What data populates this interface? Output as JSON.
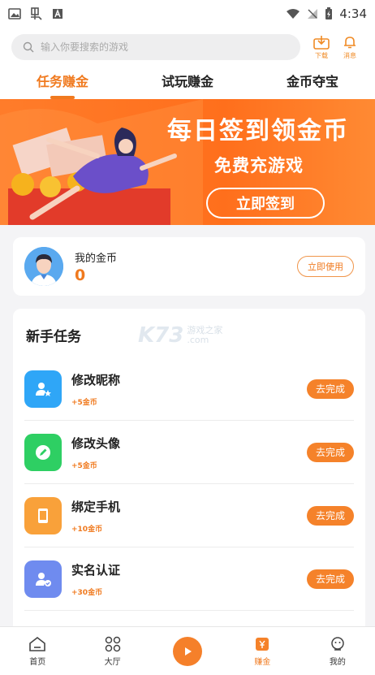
{
  "status_bar": {
    "time": "4:34"
  },
  "header": {
    "search_placeholder": "输入你要搜索的游戏",
    "download_label": "下载",
    "messages_label": "消息"
  },
  "tabs": [
    {
      "label": "任务赚金",
      "active": true
    },
    {
      "label": "试玩赚金",
      "active": false
    },
    {
      "label": "金币夺宝",
      "active": false
    }
  ],
  "banner": {
    "title": "每日签到领金币",
    "subtitle": "免费充游戏",
    "button_label": "立即签到"
  },
  "coins": {
    "label": "我的金币",
    "value": "0",
    "use_button_label": "立即使用"
  },
  "tasks": {
    "title": "新手任务",
    "items": [
      {
        "name": "修改昵称",
        "reward": "+5金币",
        "button": "去完成",
        "color": "#2fa6f7",
        "icon": "user-star-icon"
      },
      {
        "name": "修改头像",
        "reward": "+5金币",
        "button": "去完成",
        "color": "#2ecf63",
        "icon": "pencil-icon"
      },
      {
        "name": "绑定手机",
        "reward": "+10金币",
        "button": "去完成",
        "color": "#f9a13a",
        "icon": "phone-icon"
      },
      {
        "name": "实名认证",
        "reward": "+30金币",
        "button": "去完成",
        "color": "#6f8bef",
        "icon": "user-verified-icon"
      }
    ]
  },
  "watermark": {
    "logo": "K73",
    "line1": "游戏之家",
    "line2": ".com"
  },
  "bottom_nav": [
    {
      "label": "首页",
      "active": false
    },
    {
      "label": "大厅",
      "active": false
    },
    {
      "label": "",
      "active": false
    },
    {
      "label": "赚金",
      "active": true
    },
    {
      "label": "我的",
      "active": false
    }
  ],
  "colors": {
    "accent": "#f07a1f",
    "banner": "#ff7c2a"
  }
}
